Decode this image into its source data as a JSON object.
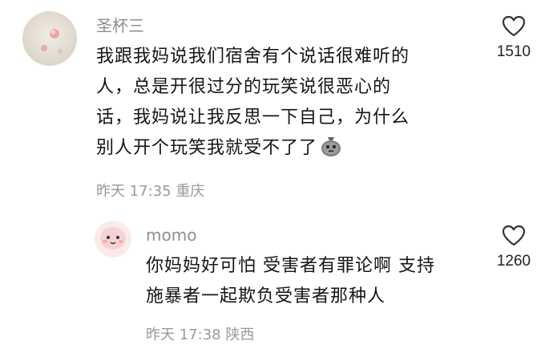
{
  "comments": [
    {
      "username": "圣杯三",
      "lines": [
        "我跟我妈说我们宿舍有个说话很难听的",
        "人，总是开很过分的玩笑说很恶心的",
        "话，我妈说让我反思一下自己，为什么",
        "别人开个玩笑我就受不了了"
      ],
      "emoji": "bag-emoji",
      "meta": "昨天 17:35 重庆",
      "likes": "1510"
    },
    {
      "username": "momo",
      "lines": [
        "你妈妈好可怕 受害者有罪论啊 支持",
        "施暴者一起欺负受害者那种人"
      ],
      "meta": "昨天 17:38 陕西",
      "likes": "1260"
    }
  ],
  "icons": {
    "like": "heart-outline-icon"
  }
}
